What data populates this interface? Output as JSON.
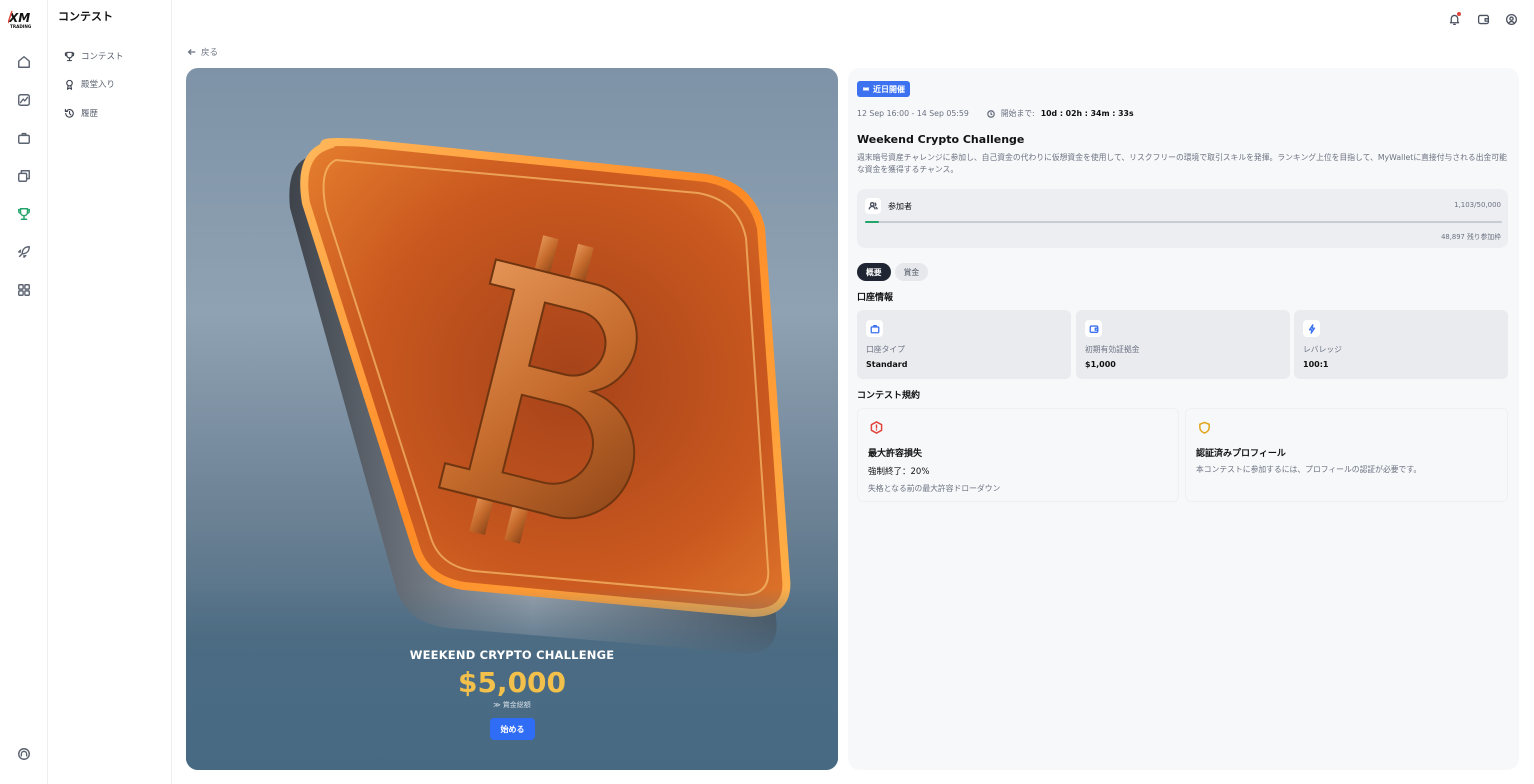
{
  "brand": {
    "logo_text": "XM",
    "logo_sub": "TRADING"
  },
  "sidebar": {
    "title": "コンテスト",
    "items": [
      {
        "label": "コンテスト",
        "icon": "trophy-icon"
      },
      {
        "label": "殿堂入り",
        "icon": "medal-icon"
      },
      {
        "label": "履歴",
        "icon": "history-icon"
      }
    ]
  },
  "nav_rail": [
    "home-icon",
    "chart-icon",
    "briefcase-icon",
    "copy-icon",
    "trophy-icon",
    "rocket-icon",
    "apps-icon",
    "support-icon"
  ],
  "header": {
    "icons": [
      "bell-icon",
      "wallet-icon",
      "account-icon"
    ]
  },
  "back": {
    "label": "戻る"
  },
  "hero": {
    "title": "WEEKEND CRYPTO CHALLENGE",
    "prize": "$5,000",
    "prize_label": "賞金総額",
    "cta": "始める"
  },
  "details": {
    "badge": "近日開催",
    "date_range": "12 Sep 16:00 - 14 Sep 05:59",
    "countdown_label": "開始まで:",
    "countdown": "10d : 02h : 34m : 33s",
    "title": "Weekend Crypto Challenge",
    "description": "週末暗号資産チャレンジに参加し、自己資金の代わりに仮想資金を使用して、リスクフリーの環境で取引スキルを発揮。ランキング上位を目指して、MyWalletに直接付与される出金可能な資金を獲得するチャンス。",
    "participants": {
      "label": "参加者",
      "count": "1,103/50,000",
      "progress": 0.022,
      "remaining": "48,897 残り参加枠"
    },
    "tabs": [
      {
        "label": "概要",
        "active": true
      },
      {
        "label": "賞金",
        "active": false
      }
    ],
    "account_section_title": "口座情報",
    "account_info": [
      {
        "label": "口座タイプ",
        "value": "Standard",
        "icon": "account-type-icon"
      },
      {
        "label": "初期有効証拠金",
        "value": "$1,000",
        "icon": "wallet-icon"
      },
      {
        "label": "レバレッジ",
        "value": "100:1",
        "icon": "lightning-icon"
      }
    ],
    "rules_section_title": "コンテスト規約",
    "rules": [
      {
        "title": "最大許容損失",
        "line": "強制終了：20%",
        "note": "失格となる前の最大許容ドローダウン",
        "icon": "alert-hexagon-icon",
        "color": "#e0453b"
      },
      {
        "title": "認証済みプロフィール",
        "note": "本コンテストに参加するには、プロフィールの認証が必要です。",
        "icon": "shield-icon",
        "color": "#e0a418"
      }
    ]
  },
  "colors": {
    "accent": "#3c72f0",
    "active_nav": "#22a46a",
    "prize": "#f3c14b",
    "cta": "#2f6df6"
  }
}
